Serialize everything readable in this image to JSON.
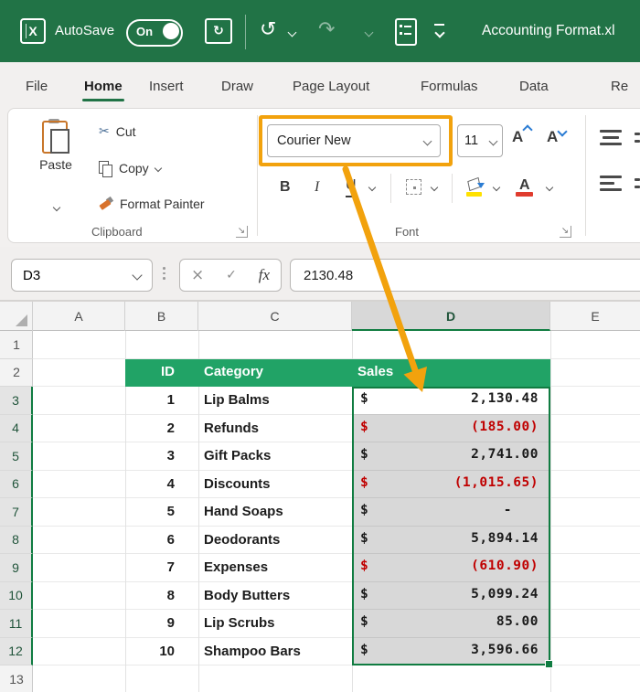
{
  "titlebar": {
    "autosave_label": "AutoSave",
    "autosave_state": "On",
    "document_title": "Accounting Format.xl"
  },
  "icons": {
    "excel_logo": "X",
    "sync": "↻",
    "undo": "↺",
    "redo": "↷",
    "scissors": "✂",
    "dialog_launcher": "↘"
  },
  "tabs": {
    "items": [
      {
        "label": "File",
        "active": false
      },
      {
        "label": "Home",
        "active": true
      },
      {
        "label": "Insert",
        "active": false
      },
      {
        "label": "Draw",
        "active": false
      },
      {
        "label": "Page Layout",
        "active": false
      },
      {
        "label": "Formulas",
        "active": false
      },
      {
        "label": "Data",
        "active": false
      },
      {
        "label": "Re",
        "active": false
      }
    ]
  },
  "ribbon": {
    "clipboard": {
      "paste_label": "Paste",
      "cut_label": "Cut",
      "copy_label": "Copy",
      "format_painter_label": "Format Painter",
      "group_label": "Clipboard"
    },
    "font": {
      "font_name": "Courier New",
      "font_size": "11",
      "bold_label": "B",
      "italic_label": "I",
      "underline_label": "U",
      "grow_font_label": "A",
      "shrink_font_label": "A",
      "font_color_label": "A",
      "group_label": "Font"
    }
  },
  "formula_bar": {
    "cell_reference": "D3",
    "cancel_glyph": "×",
    "enter_glyph": "✓",
    "fx_glyph": "fx",
    "formula_value": "2130.48"
  },
  "grid": {
    "column_headers": [
      "A",
      "B",
      "C",
      "D",
      "E"
    ],
    "selected_column": "D",
    "row_numbers": [
      "1",
      "2",
      "3",
      "4",
      "5",
      "6",
      "7",
      "8",
      "9",
      "10",
      "11",
      "12",
      "13"
    ],
    "selected_row_range": [
      3,
      12
    ],
    "active_cell": "D3",
    "table_header": {
      "id": "ID",
      "category": "Category",
      "sales": "Sales"
    },
    "rows": [
      {
        "n": 3,
        "id": "1",
        "category": "Lip Balms",
        "currency": "$",
        "amount": "2,130.48",
        "negative": false
      },
      {
        "n": 4,
        "id": "2",
        "category": "Refunds",
        "currency": "$",
        "amount": "(185.00)",
        "negative": true
      },
      {
        "n": 5,
        "id": "3",
        "category": "Gift Packs",
        "currency": "$",
        "amount": "2,741.00",
        "negative": false
      },
      {
        "n": 6,
        "id": "4",
        "category": "Discounts",
        "currency": "$",
        "amount": "(1,015.65)",
        "negative": true
      },
      {
        "n": 7,
        "id": "5",
        "category": "Hand Soaps",
        "currency": "$",
        "amount": "-",
        "negative": false
      },
      {
        "n": 8,
        "id": "6",
        "category": "Deodorants",
        "currency": "$",
        "amount": "5,894.14",
        "negative": false
      },
      {
        "n": 9,
        "id": "7",
        "category": "Expenses",
        "currency": "$",
        "amount": "(610.90)",
        "negative": true
      },
      {
        "n": 10,
        "id": "8",
        "category": "Body Butters",
        "currency": "$",
        "amount": "5,099.24",
        "negative": false
      },
      {
        "n": 11,
        "id": "9",
        "category": "Lip Scrubs",
        "currency": "$",
        "amount": "85.00",
        "negative": false
      },
      {
        "n": 12,
        "id": "10",
        "category": "Shampoo Bars",
        "currency": "$",
        "amount": "3,596.66",
        "negative": false
      }
    ]
  },
  "colors": {
    "titlebar_green": "#217346",
    "table_header_green": "#21A366",
    "selection_green": "#107C41",
    "negative_red": "#C00000",
    "annotation_orange": "#F2A20D",
    "selected_fill": "#D8D8D8"
  }
}
